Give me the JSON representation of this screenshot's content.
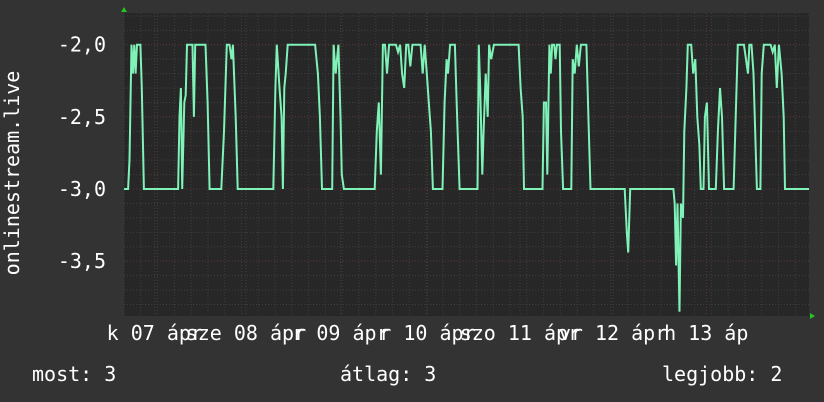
{
  "chart_data": {
    "type": "line",
    "ylabel": "onlinestream.live",
    "yticks": [
      "-2,0",
      "-2,5",
      "-3,0",
      "-3,5"
    ],
    "ytick_values": [
      -2.0,
      -2.5,
      -3.0,
      -3.5
    ],
    "ylim": [
      -3.88,
      -1.78
    ],
    "xlim": [
      0,
      100
    ],
    "xticks": [
      {
        "x": 4.5,
        "label": "k 07 ápr"
      },
      {
        "x": 17.8,
        "label": "sze 08 ápr"
      },
      {
        "x": 31.6,
        "label": "r 09 ápr"
      },
      {
        "x": 44.3,
        "label": "r 10 ápr"
      },
      {
        "x": 57.8,
        "label": "szo 11 ápr"
      },
      {
        "x": 71.4,
        "label": "vr 12 ápr"
      },
      {
        "x": 85.0,
        "label": "h 13 áp"
      }
    ],
    "grid": true,
    "colors": {
      "background": "#333333",
      "plot_background": "#272727",
      "line": "#7ff2b8",
      "grid_minor": "#3f3f3f",
      "grid_major": "#5a3535",
      "axis_marker": "#22c422"
    },
    "series": [
      {
        "values": [
          [
            0,
            -3.0
          ],
          [
            0.6,
            -3.0
          ],
          [
            0.8,
            -2.8
          ],
          [
            1.1,
            -2.0
          ],
          [
            1.3,
            -2.2
          ],
          [
            1.5,
            -2.0
          ],
          [
            1.7,
            -2.2
          ],
          [
            1.9,
            -2.0
          ],
          [
            2.4,
            -2.0
          ],
          [
            2.6,
            -2.3
          ],
          [
            2.9,
            -3.0
          ],
          [
            7.9,
            -3.0
          ],
          [
            8.1,
            -2.5
          ],
          [
            8.3,
            -2.3
          ],
          [
            8.5,
            -3.0
          ],
          [
            8.8,
            -2.4
          ],
          [
            9.0,
            -2.35
          ],
          [
            9.2,
            -2.0
          ],
          [
            9.7,
            -2.0
          ],
          [
            10.0,
            -2.0
          ],
          [
            10.2,
            -2.5
          ],
          [
            10.4,
            -2.0
          ],
          [
            11.9,
            -2.0
          ],
          [
            12.2,
            -2.4
          ],
          [
            12.5,
            -3.0
          ],
          [
            14.2,
            -3.0
          ],
          [
            14.6,
            -2.6
          ],
          [
            15.0,
            -2.0
          ],
          [
            15.4,
            -2.0
          ],
          [
            15.7,
            -2.1
          ],
          [
            15.9,
            -2.0
          ],
          [
            16.3,
            -2.5
          ],
          [
            16.6,
            -3.0
          ],
          [
            21.8,
            -3.0
          ],
          [
            22.1,
            -2.3
          ],
          [
            22.3,
            -2.0
          ],
          [
            22.7,
            -2.3
          ],
          [
            23.0,
            -2.5
          ],
          [
            23.2,
            -3.0
          ],
          [
            23.4,
            -2.3
          ],
          [
            23.6,
            -2.2
          ],
          [
            23.9,
            -2.0
          ],
          [
            27.9,
            -2.0
          ],
          [
            28.3,
            -2.2
          ],
          [
            28.6,
            -2.5
          ],
          [
            28.9,
            -3.0
          ],
          [
            30.4,
            -3.0
          ],
          [
            30.6,
            -2.0
          ],
          [
            30.9,
            -2.2
          ],
          [
            31.1,
            -2.1
          ],
          [
            31.3,
            -2.0
          ],
          [
            31.6,
            -2.5
          ],
          [
            31.8,
            -2.9
          ],
          [
            32.1,
            -3.0
          ],
          [
            36.6,
            -3.0
          ],
          [
            36.9,
            -2.6
          ],
          [
            37.2,
            -2.4
          ],
          [
            37.5,
            -2.9
          ],
          [
            37.8,
            -2.0
          ],
          [
            38.1,
            -2.0
          ],
          [
            38.4,
            -2.2
          ],
          [
            38.7,
            -2.0
          ],
          [
            39.7,
            -2.0
          ],
          [
            40.0,
            -2.05
          ],
          [
            40.3,
            -2.0
          ],
          [
            40.6,
            -2.2
          ],
          [
            40.9,
            -2.3
          ],
          [
            41.2,
            -2.0
          ],
          [
            41.5,
            -2.0
          ],
          [
            41.8,
            -2.15
          ],
          [
            42.1,
            -2.0
          ],
          [
            43.3,
            -2.0
          ],
          [
            43.6,
            -2.2
          ],
          [
            43.9,
            -2.0
          ],
          [
            44.2,
            -2.2
          ],
          [
            44.5,
            -2.4
          ],
          [
            44.8,
            -2.6
          ],
          [
            45.1,
            -3.0
          ],
          [
            46.5,
            -3.0
          ],
          [
            46.8,
            -2.4
          ],
          [
            47.1,
            -2.1
          ],
          [
            47.3,
            -2.2
          ],
          [
            47.6,
            -2.0
          ],
          [
            48.3,
            -2.0
          ],
          [
            48.5,
            -2.3
          ],
          [
            48.7,
            -2.6
          ],
          [
            49.0,
            -3.0
          ],
          [
            51.6,
            -3.0
          ],
          [
            51.8,
            -2.0
          ],
          [
            52.0,
            -2.3
          ],
          [
            52.3,
            -2.9
          ],
          [
            52.5,
            -2.6
          ],
          [
            52.8,
            -2.2
          ],
          [
            53.1,
            -2.5
          ],
          [
            53.3,
            -2.0
          ],
          [
            53.6,
            -2.1
          ],
          [
            54.0,
            -2.0
          ],
          [
            57.6,
            -2.0
          ],
          [
            57.9,
            -2.3
          ],
          [
            58.2,
            -2.5
          ],
          [
            58.4,
            -3.0
          ],
          [
            61.1,
            -3.0
          ],
          [
            61.3,
            -2.4
          ],
          [
            61.6,
            -2.4
          ],
          [
            61.8,
            -2.9
          ],
          [
            62.1,
            -2.0
          ],
          [
            62.3,
            -2.2
          ],
          [
            62.5,
            -2.0
          ],
          [
            62.8,
            -2.0
          ],
          [
            63.0,
            -2.1
          ],
          [
            63.2,
            -2.0
          ],
          [
            63.6,
            -2.0
          ],
          [
            63.8,
            -2.6
          ],
          [
            64.1,
            -3.0
          ],
          [
            65.3,
            -3.0
          ],
          [
            65.5,
            -2.1
          ],
          [
            65.8,
            -2.2
          ],
          [
            66.1,
            -2.0
          ],
          [
            66.4,
            -2.15
          ],
          [
            66.7,
            -2.0
          ],
          [
            67.5,
            -2.0
          ],
          [
            67.8,
            -2.5
          ],
          [
            68.1,
            -3.0
          ],
          [
            73.1,
            -3.0
          ],
          [
            73.4,
            -3.3
          ],
          [
            73.6,
            -3.44
          ],
          [
            73.9,
            -3.0
          ],
          [
            80.2,
            -3.0
          ],
          [
            80.4,
            -3.1
          ],
          [
            80.6,
            -3.53
          ],
          [
            80.8,
            -3.1
          ],
          [
            81.1,
            -3.85
          ],
          [
            81.3,
            -3.1
          ],
          [
            81.6,
            -3.2
          ],
          [
            81.8,
            -2.6
          ],
          [
            82.1,
            -2.3
          ],
          [
            82.3,
            -2.0
          ],
          [
            82.8,
            -2.0
          ],
          [
            83.1,
            -2.2
          ],
          [
            83.4,
            -2.1
          ],
          [
            83.7,
            -2.5
          ],
          [
            84.0,
            -2.7
          ],
          [
            84.2,
            -3.0
          ],
          [
            84.6,
            -3.0
          ],
          [
            84.8,
            -2.5
          ],
          [
            85.1,
            -2.4
          ],
          [
            85.4,
            -3.0
          ],
          [
            86.4,
            -3.0
          ],
          [
            86.7,
            -2.6
          ],
          [
            87.0,
            -2.3
          ],
          [
            87.3,
            -2.5
          ],
          [
            87.6,
            -3.0
          ],
          [
            89.0,
            -3.0
          ],
          [
            89.3,
            -2.5
          ],
          [
            89.6,
            -2.0
          ],
          [
            90.5,
            -2.0
          ],
          [
            90.8,
            -2.1
          ],
          [
            91.1,
            -2.2
          ],
          [
            91.3,
            -2.0
          ],
          [
            91.6,
            -2.0
          ],
          [
            91.9,
            -2.2
          ],
          [
            92.2,
            -2.7
          ],
          [
            92.4,
            -3.0
          ],
          [
            92.9,
            -3.0
          ],
          [
            93.1,
            -2.2
          ],
          [
            93.4,
            -2.0
          ],
          [
            94.4,
            -2.0
          ],
          [
            94.7,
            -2.05
          ],
          [
            95.0,
            -2.0
          ],
          [
            95.3,
            -2.3
          ],
          [
            95.6,
            -2.0
          ],
          [
            96.0,
            -2.2
          ],
          [
            96.3,
            -2.5
          ],
          [
            96.5,
            -3.0
          ],
          [
            100,
            -3.0
          ]
        ]
      }
    ]
  },
  "stats": {
    "now": "most: 3",
    "avg": "átlag: 3",
    "best": "legjobb: 2"
  }
}
